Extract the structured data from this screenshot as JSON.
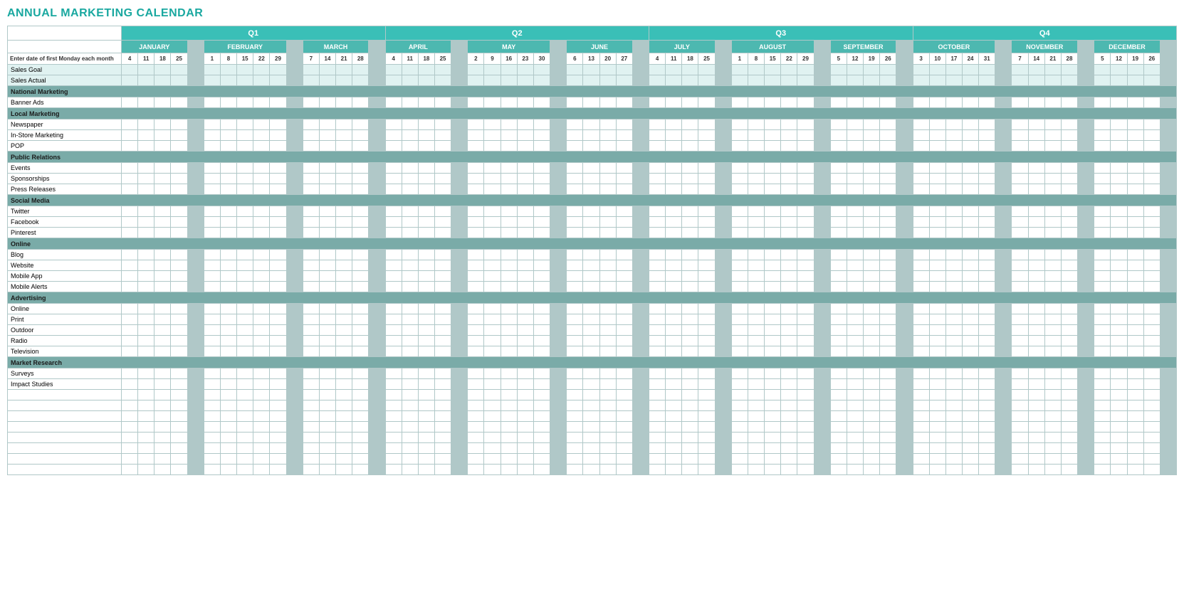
{
  "title": "ANNUAL MARKETING CALENDAR",
  "quarters": [
    {
      "label": "Q1",
      "months": [
        "JANUARY",
        "FEBRUARY",
        "MARCH"
      ],
      "span": 15
    },
    {
      "label": "Q2",
      "months": [
        "APRIL",
        "MAY",
        "JUNE"
      ],
      "span": 15
    },
    {
      "label": "Q3",
      "months": [
        "JULY",
        "AUGUST",
        "SEPTEMBER"
      ],
      "span": 15
    },
    {
      "label": "Q4",
      "months": [
        "OCTOBER",
        "NOVEMBER",
        "DECEMBER"
      ],
      "span": 15
    }
  ],
  "months": {
    "JANUARY": {
      "dates": [
        "4",
        "11",
        "18",
        "25"
      ]
    },
    "FEBRUARY": {
      "dates": [
        "1",
        "8",
        "15",
        "22",
        "29"
      ]
    },
    "MARCH": {
      "dates": [
        "7",
        "14",
        "21",
        "28"
      ]
    },
    "APRIL": {
      "dates": [
        "4",
        "11",
        "18",
        "25"
      ]
    },
    "MAY": {
      "dates": [
        "2",
        "9",
        "16",
        "23",
        "30"
      ]
    },
    "JUNE": {
      "dates": [
        "6",
        "13",
        "20",
        "27"
      ]
    },
    "JULY": {
      "dates": [
        "4",
        "11",
        "18",
        "25"
      ]
    },
    "AUGUST": {
      "dates": [
        "1",
        "8",
        "15",
        "22",
        "29"
      ]
    },
    "SEPTEMBER": {
      "dates": [
        "5",
        "12",
        "19",
        "26"
      ]
    },
    "OCTOBER": {
      "dates": [
        "3",
        "10",
        "17",
        "24",
        "31"
      ]
    },
    "NOVEMBER": {
      "dates": [
        "7",
        "14",
        "21",
        "28"
      ]
    },
    "DECEMBER": {
      "dates": [
        "5",
        "12",
        "19",
        "26"
      ]
    }
  },
  "first_column_label": "Enter date of first Monday each month",
  "categories": [
    {
      "type": "sales",
      "label": "Sales Goal"
    },
    {
      "type": "sales",
      "label": "Sales Actual"
    },
    {
      "type": "category",
      "label": "National Marketing"
    },
    {
      "type": "item",
      "label": "Banner Ads"
    },
    {
      "type": "category",
      "label": "Local Marketing"
    },
    {
      "type": "item",
      "label": "Newspaper"
    },
    {
      "type": "item",
      "label": "In-Store Marketing"
    },
    {
      "type": "item",
      "label": "POP"
    },
    {
      "type": "category",
      "label": "Public Relations"
    },
    {
      "type": "item",
      "label": "Events"
    },
    {
      "type": "item",
      "label": "Sponsorships"
    },
    {
      "type": "item",
      "label": "Press Releases"
    },
    {
      "type": "category",
      "label": "Social Media"
    },
    {
      "type": "item",
      "label": "Twitter"
    },
    {
      "type": "item",
      "label": "Facebook"
    },
    {
      "type": "item",
      "label": "Pinterest"
    },
    {
      "type": "category",
      "label": "Online"
    },
    {
      "type": "item",
      "label": "Blog"
    },
    {
      "type": "item",
      "label": "Website"
    },
    {
      "type": "item",
      "label": "Mobile App"
    },
    {
      "type": "item",
      "label": "Mobile Alerts"
    },
    {
      "type": "category",
      "label": "Advertising"
    },
    {
      "type": "item",
      "label": "Online"
    },
    {
      "type": "item",
      "label": "Print"
    },
    {
      "type": "item",
      "label": "Outdoor"
    },
    {
      "type": "item",
      "label": "Radio"
    },
    {
      "type": "item",
      "label": "Television"
    },
    {
      "type": "category",
      "label": "Market Research"
    },
    {
      "type": "item",
      "label": "Surveys"
    },
    {
      "type": "item",
      "label": "Impact Studies"
    },
    {
      "type": "empty",
      "label": ""
    },
    {
      "type": "empty",
      "label": ""
    },
    {
      "type": "empty",
      "label": ""
    },
    {
      "type": "empty",
      "label": ""
    },
    {
      "type": "empty",
      "label": ""
    },
    {
      "type": "empty",
      "label": ""
    },
    {
      "type": "empty",
      "label": ""
    },
    {
      "type": "empty",
      "label": ""
    }
  ]
}
